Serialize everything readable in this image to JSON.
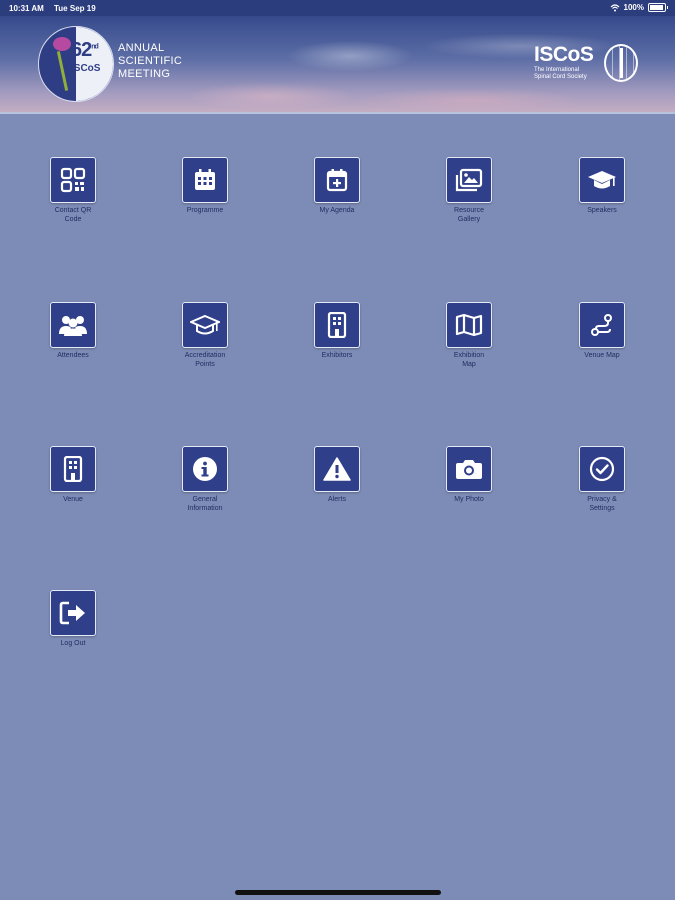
{
  "status_bar": {
    "time": "10:31 AM",
    "date": "Tue Sep 19",
    "battery": "100%"
  },
  "header": {
    "logo_number": "62",
    "logo_superscript": "nd",
    "logo_org": "ISCoS",
    "meeting_line1": "ANNUAL",
    "meeting_line2": "SCIENTIFIC",
    "meeting_line3": "MEETING",
    "brand_name": "ISCoS",
    "brand_tagline_1": "The International",
    "brand_tagline_2": "Spinal Cord Society"
  },
  "colors": {
    "background": "#7d8cb7",
    "tile": "#2f3f8a",
    "status_bar": "#2c3d7e"
  },
  "menu": [
    {
      "label1": "Contact QR",
      "label2": "Code",
      "icon": "qr-code-icon"
    },
    {
      "label1": "Programme",
      "label2": "",
      "icon": "calendar-grid-icon"
    },
    {
      "label1": "My Agenda",
      "label2": "",
      "icon": "calendar-add-icon"
    },
    {
      "label1": "Resource",
      "label2": "Gallery",
      "icon": "gallery-icon"
    },
    {
      "label1": "Speakers",
      "label2": "",
      "icon": "graduation-cap-icon"
    },
    {
      "label1": "Attendees",
      "label2": "",
      "icon": "people-icon"
    },
    {
      "label1": "Accreditation",
      "label2": "Points",
      "icon": "graduation-cap-icon"
    },
    {
      "label1": "Exhibitors",
      "label2": "",
      "icon": "building-icon"
    },
    {
      "label1": "Exhibition",
      "label2": "Map",
      "icon": "map-icon"
    },
    {
      "label1": "Venue Map",
      "label2": "",
      "icon": "route-icon"
    },
    {
      "label1": "Venue",
      "label2": "",
      "icon": "building-icon"
    },
    {
      "label1": "General",
      "label2": "Information",
      "icon": "info-icon"
    },
    {
      "label1": "Alerts",
      "label2": "",
      "icon": "warning-icon"
    },
    {
      "label1": "My Photo",
      "label2": "",
      "icon": "camera-icon"
    },
    {
      "label1": "Privacy &",
      "label2": "Settings",
      "icon": "check-circle-icon"
    },
    {
      "label1": "Log Out",
      "label2": "",
      "icon": "logout-icon"
    }
  ]
}
